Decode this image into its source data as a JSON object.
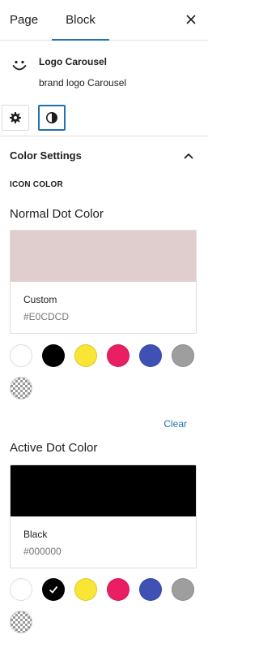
{
  "tabs": {
    "page_label": "Page",
    "block_label": "Block"
  },
  "block": {
    "title": "Logo Carousel",
    "description": "brand logo Carousel"
  },
  "color_settings": {
    "title": "Color Settings",
    "caption": "ICON COLOR",
    "normal": {
      "heading": "Normal Dot Color",
      "swatch_name": "Custom",
      "swatch_hex": "#E0CDCD",
      "swatch_color": "#e0cdcd"
    },
    "clear_label": "Clear",
    "active": {
      "heading": "Active Dot Color",
      "swatch_name": "Black",
      "swatch_hex": "#000000",
      "swatch_color": "#000000",
      "selected": "black"
    },
    "palette": [
      "#ffffff",
      "#000000",
      "#f9e533",
      "#e91e63",
      "#3f51b5",
      "#9e9e9e",
      "checkerboard"
    ]
  },
  "accent_color": "#2271b1"
}
